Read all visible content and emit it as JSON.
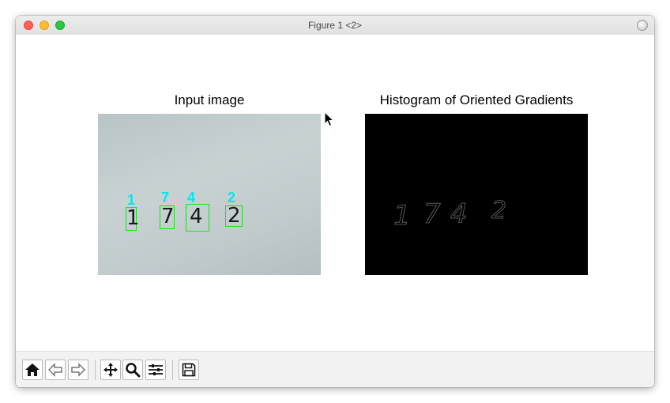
{
  "window": {
    "title": "Figure 1 <2>"
  },
  "figure": {
    "subplots": [
      {
        "title": "Input image",
        "digits": [
          {
            "label": "1",
            "char": "1"
          },
          {
            "label": "7",
            "char": "7"
          },
          {
            "label": "4",
            "char": "4"
          },
          {
            "label": "2",
            "char": "2"
          }
        ]
      },
      {
        "title": "Histogram of Oriented Gradients",
        "digits": [
          {
            "char": "1"
          },
          {
            "char": "7"
          },
          {
            "char": "4"
          },
          {
            "char": "2"
          }
        ]
      }
    ]
  },
  "toolbar": {
    "buttons": [
      {
        "name": "home",
        "icon": "home-icon"
      },
      {
        "name": "back",
        "icon": "back-arrow-icon"
      },
      {
        "name": "forward",
        "icon": "forward-arrow-icon"
      },
      {
        "name": "pan",
        "icon": "pan-move-icon"
      },
      {
        "name": "zoom",
        "icon": "zoom-magnifier-icon"
      },
      {
        "name": "configure-subplots",
        "icon": "sliders-icon"
      },
      {
        "name": "save",
        "icon": "floppy-disk-icon"
      }
    ]
  },
  "colors": {
    "box": "#17e312",
    "label": "#00e8f0",
    "hog_background": "#000000"
  }
}
